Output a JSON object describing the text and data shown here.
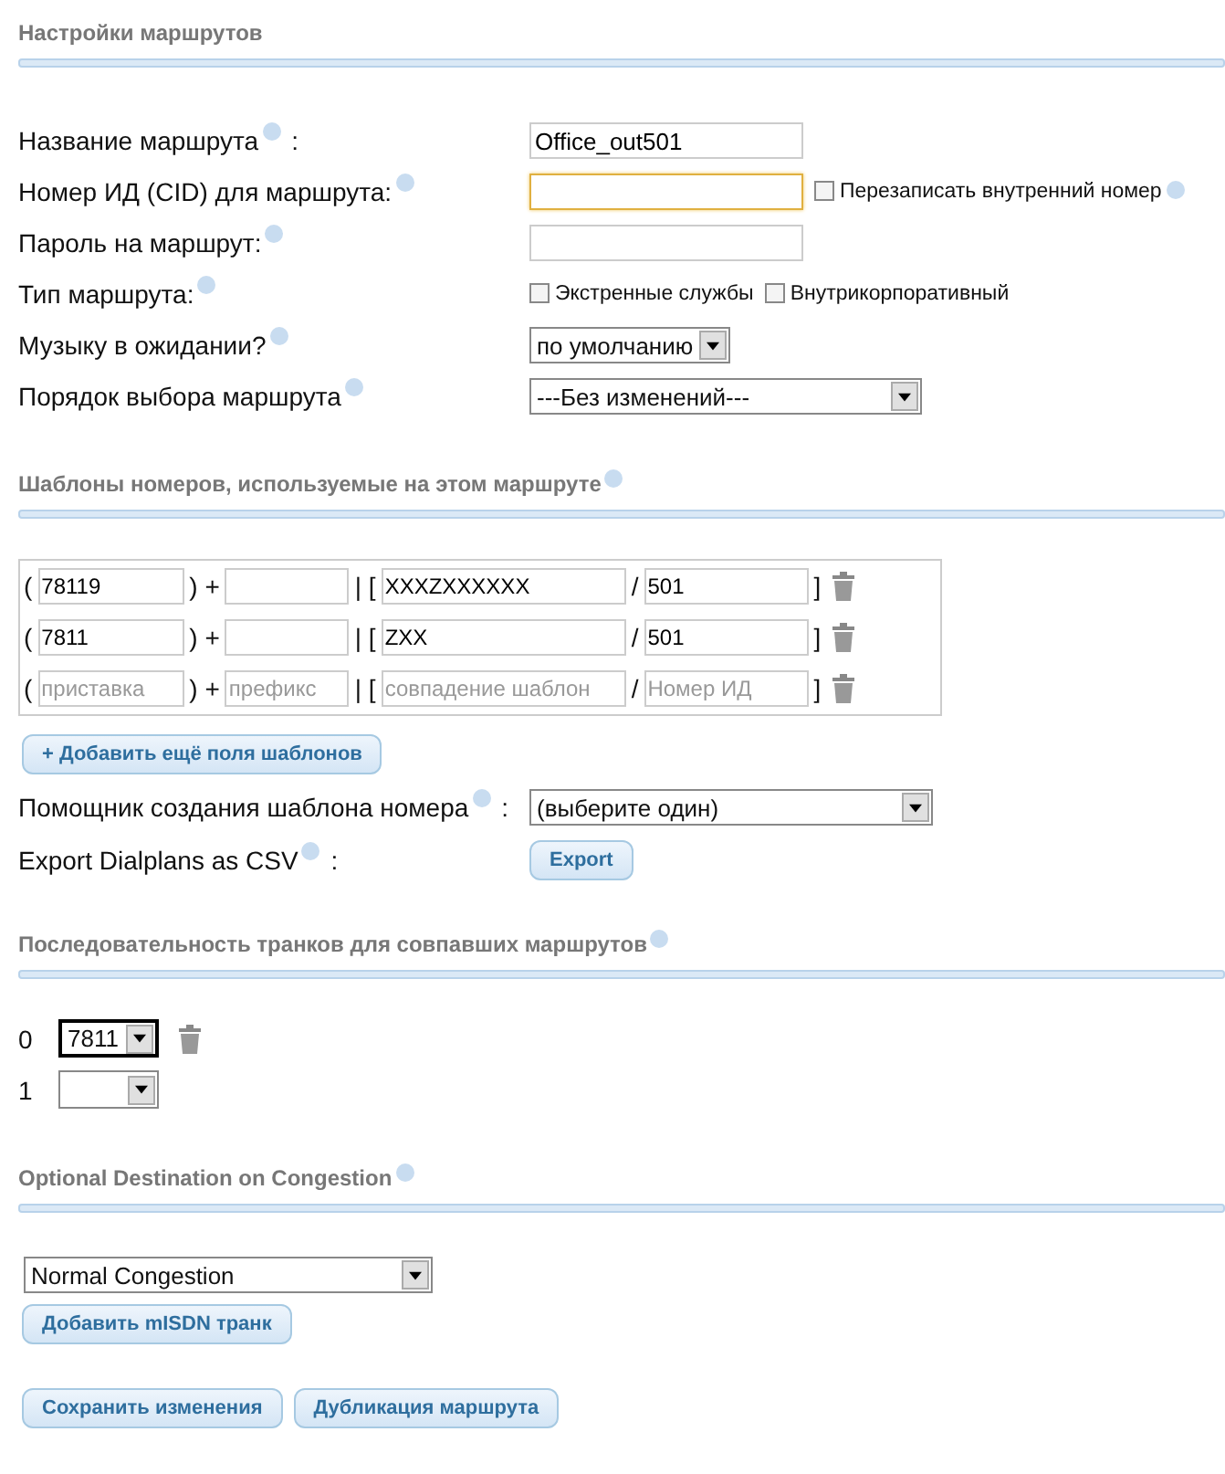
{
  "route_settings": {
    "title": "Настройки маршрутов",
    "help": false,
    "rows": [
      {
        "kind": "text",
        "label": "Название маршрута",
        "after": ":",
        "value": "Office_out501",
        "focused": false
      },
      {
        "kind": "text",
        "label": "Номер ИД (CID) для маршрута:",
        "focused": true,
        "checkboxes": [
          {
            "label": "Перезаписать внутренний номер",
            "checked": false,
            "help": true
          }
        ]
      },
      {
        "kind": "text",
        "label": "Пароль на маршрут:",
        "focused": false
      },
      {
        "kind": "checkboxes",
        "label": "Тип маршрута:",
        "checkboxes": [
          {
            "label": "Экстренные службы",
            "checked": false,
            "help": false
          },
          {
            "label": "Внутрикорпоративный",
            "checked": false,
            "help": false
          }
        ]
      },
      {
        "kind": "select",
        "label": "Музыку в ожидании?",
        "value": "по умолчанию"
      },
      {
        "kind": "select",
        "label": "Порядок выбора маршрута",
        "value": "---Без изменений---"
      }
    ]
  },
  "patterns": {
    "title": "Шаблоны номеров, используемые на этом маршруте",
    "help": true,
    "rows": [
      {
        "parts": [
          {
            "kind": "text",
            "text": "("
          },
          {
            "kind": "field",
            "value": "78119"
          },
          {
            "kind": "text",
            "text": ") +"
          },
          {
            "kind": "field"
          },
          {
            "kind": "text",
            "text": "| ["
          },
          {
            "kind": "field",
            "value": "XXXZXXXXXX"
          },
          {
            "kind": "text",
            "text": "/"
          },
          {
            "kind": "field",
            "value": "501"
          },
          {
            "kind": "text",
            "text": "]"
          }
        ]
      },
      {
        "parts": [
          {
            "kind": "text",
            "text": "("
          },
          {
            "kind": "field",
            "value": "7811"
          },
          {
            "kind": "text",
            "text": ") +"
          },
          {
            "kind": "field"
          },
          {
            "kind": "text",
            "text": "| ["
          },
          {
            "kind": "field",
            "value": "ZXX"
          },
          {
            "kind": "text",
            "text": "/"
          },
          {
            "kind": "field",
            "value": "501"
          },
          {
            "kind": "text",
            "text": "]"
          }
        ]
      },
      {
        "parts": [
          {
            "kind": "text",
            "text": "("
          },
          {
            "kind": "field",
            "placeholder": "приставка"
          },
          {
            "kind": "text",
            "text": ") +"
          },
          {
            "kind": "field",
            "placeholder": "префикс"
          },
          {
            "kind": "text",
            "text": "| ["
          },
          {
            "kind": "field",
            "placeholder": "совпадение шаблон"
          },
          {
            "kind": "text",
            "text": "/"
          },
          {
            "kind": "field",
            "placeholder": "Номер ИД"
          },
          {
            "kind": "text",
            "text": "]"
          }
        ]
      }
    ],
    "add_button": "+ Добавить ещё поля шаблонов",
    "wizard": {
      "label": "Помощник создания шаблона номера",
      "after": ":",
      "value": "(выберите один)"
    },
    "export": {
      "label": "Export Dialplans as CSV",
      "after": ":",
      "button": "Export"
    }
  },
  "trunks": {
    "title": "Последовательность транков для совпавших маршрутов",
    "help": true,
    "rows": [
      {
        "index": "0",
        "value": "7811",
        "focused": true,
        "removable": true
      },
      {
        "index": "1",
        "focused": false,
        "removable": false
      }
    ]
  },
  "congestion": {
    "title": "Optional Destination on Congestion",
    "help": true,
    "value": "Normal Congestion",
    "button": "Добавить mISDN транк"
  },
  "footer_buttons": [
    "Сохранить изменения",
    "Дубликация маршрута"
  ]
}
